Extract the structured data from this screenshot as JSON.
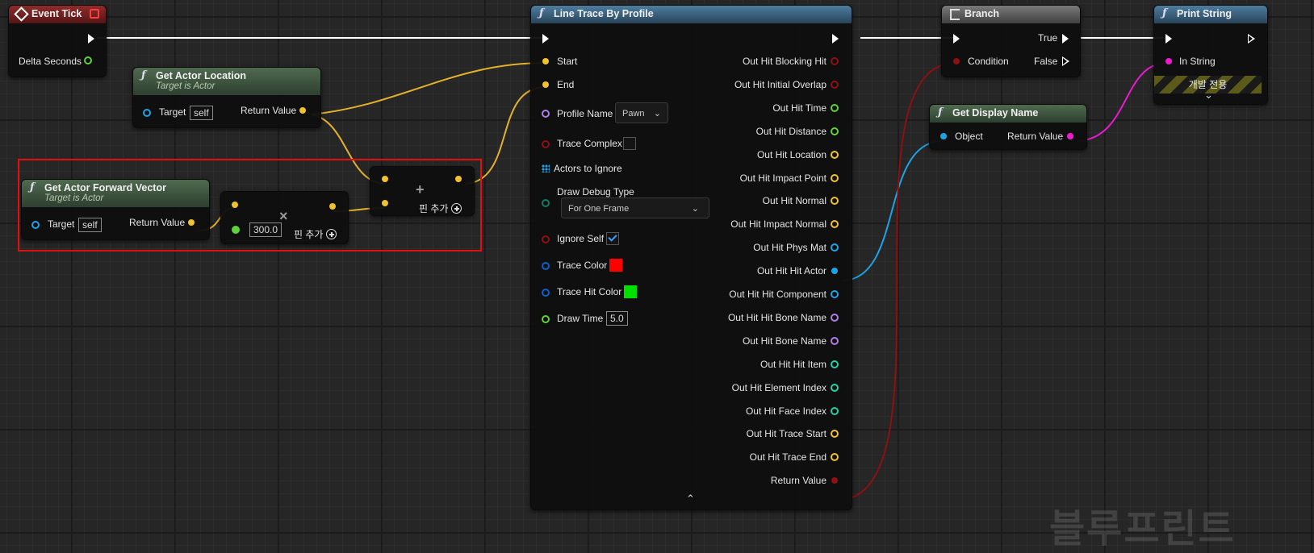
{
  "nodes": {
    "event_tick": {
      "title": "Event Tick",
      "pins": {
        "delta": "Delta Seconds"
      }
    },
    "get_actor_location": {
      "title": "Get Actor Location",
      "subtitle": "Target is Actor",
      "target": "Target",
      "target_value": "self",
      "return": "Return Value"
    },
    "get_forward": {
      "title": "Get Actor Forward Vector",
      "subtitle": "Target is Actor",
      "target": "Target",
      "target_value": "self",
      "return": "Return Value"
    },
    "multiply": {
      "operator": "×",
      "value": "300.0",
      "add_pin": "핀 추가"
    },
    "add": {
      "operator": "+",
      "add_pin": "핀 추가"
    },
    "line_trace": {
      "title": "Line Trace By Profile",
      "inputs": {
        "start": "Start",
        "end": "End",
        "profile_name": "Profile Name",
        "profile_value": "Pawn",
        "trace_complex": "Trace Complex",
        "actors_to_ignore": "Actors to Ignore",
        "draw_debug_type": "Draw Debug Type",
        "draw_debug_value": "For One Frame",
        "ignore_self": "Ignore Self",
        "trace_color": "Trace Color",
        "trace_hit_color": "Trace Hit Color",
        "draw_time": "Draw Time",
        "draw_time_value": "5.0"
      },
      "outputs": [
        "Out Hit Blocking Hit",
        "Out Hit Initial Overlap",
        "Out Hit Time",
        "Out Hit Distance",
        "Out Hit Location",
        "Out Hit Impact Point",
        "Out Hit Normal",
        "Out Hit Impact Normal",
        "Out Hit Phys Mat",
        "Out Hit Hit Actor",
        "Out Hit Hit Component",
        "Out Hit Hit Bone Name",
        "Out Hit Bone Name",
        "Out Hit Hit Item",
        "Out Hit Element Index",
        "Out Hit Face Index",
        "Out Hit Trace Start",
        "Out Hit Trace End",
        "Return Value"
      ]
    },
    "branch": {
      "title": "Branch",
      "condition": "Condition",
      "true_label": "True",
      "false_label": "False"
    },
    "get_display_name": {
      "title": "Get Display Name",
      "object": "Object",
      "return": "Return Value"
    },
    "print_string": {
      "title": "Print String",
      "in_string": "In String",
      "dev_only": "개발 전용"
    }
  },
  "watermark": "블루프린트",
  "colors": {
    "exec": "#ffffff",
    "vector": "#f2c12e",
    "object": "#1ba4e6",
    "bool": "#8e1010",
    "float": "#5fd13a",
    "name": "#b07ce8",
    "string": "#f01bd0",
    "struct": "#0b7fd8",
    "linear_color": "#0b5fd0",
    "int": "#1fd1a8",
    "selection": "#e01010"
  }
}
